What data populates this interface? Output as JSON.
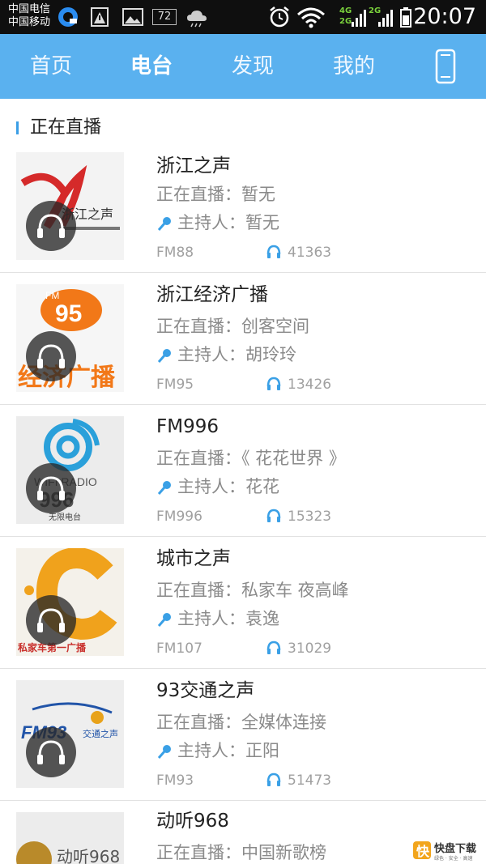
{
  "statusbar": {
    "carrier1": "中国电信",
    "carrier2": "中国移动",
    "badge": "72",
    "net_4g": "4G",
    "net_2g_a": "2G",
    "net_2g_b": "2G",
    "time": "20:07"
  },
  "nav": {
    "tabs": [
      {
        "label": "首页"
      },
      {
        "label": "电台"
      },
      {
        "label": "发现"
      },
      {
        "label": "我的"
      }
    ],
    "active_tab": "电台"
  },
  "section": {
    "title": "正在直播"
  },
  "labels": {
    "live_prefix": "正在直播：",
    "host_prefix": "主持人："
  },
  "stations": [
    {
      "name": "浙江之声",
      "live": "暂无",
      "host": "暂无",
      "fm": "FM88",
      "listeners": "41363"
    },
    {
      "name": "浙江经济广播",
      "live": "创客空间",
      "host": "胡玲玲",
      "fm": "FM95",
      "listeners": "13426"
    },
    {
      "name": "FM996",
      "live": "《 花花世界 》",
      "host": "花花",
      "fm": "FM996",
      "listeners": "15323"
    },
    {
      "name": "城市之声",
      "live": "私家车 夜高峰",
      "host": "袁逸",
      "fm": "FM107",
      "listeners": "31029"
    },
    {
      "name": "93交通之声",
      "live": "全媒体连接",
      "host": "正阳",
      "fm": "FM93",
      "listeners": "51473"
    },
    {
      "name": "动听968",
      "live": "中国新歌榜",
      "host": "",
      "fm": "",
      "listeners": ""
    }
  ],
  "logos": {
    "s2_text": "经济广播",
    "s2_badge": "95",
    "s2_fm": "FM",
    "s3_text1": "WIFI RADIO",
    "s3_text2": "996",
    "s3_text3": "无限电台",
    "s4_text": "私家车第一广播",
    "s5_text": "FM93",
    "s5_text2": "交通之声",
    "s6_text": "动听968",
    "s1_text": "浙江之声"
  },
  "watermark": {
    "text": "快盘下载",
    "sub": "绿色 · 安全 · 高速"
  },
  "colors": {
    "nav": "#5ab1ef",
    "accent": "#3b9ee6",
    "statusbar": "#0f0f0f"
  }
}
